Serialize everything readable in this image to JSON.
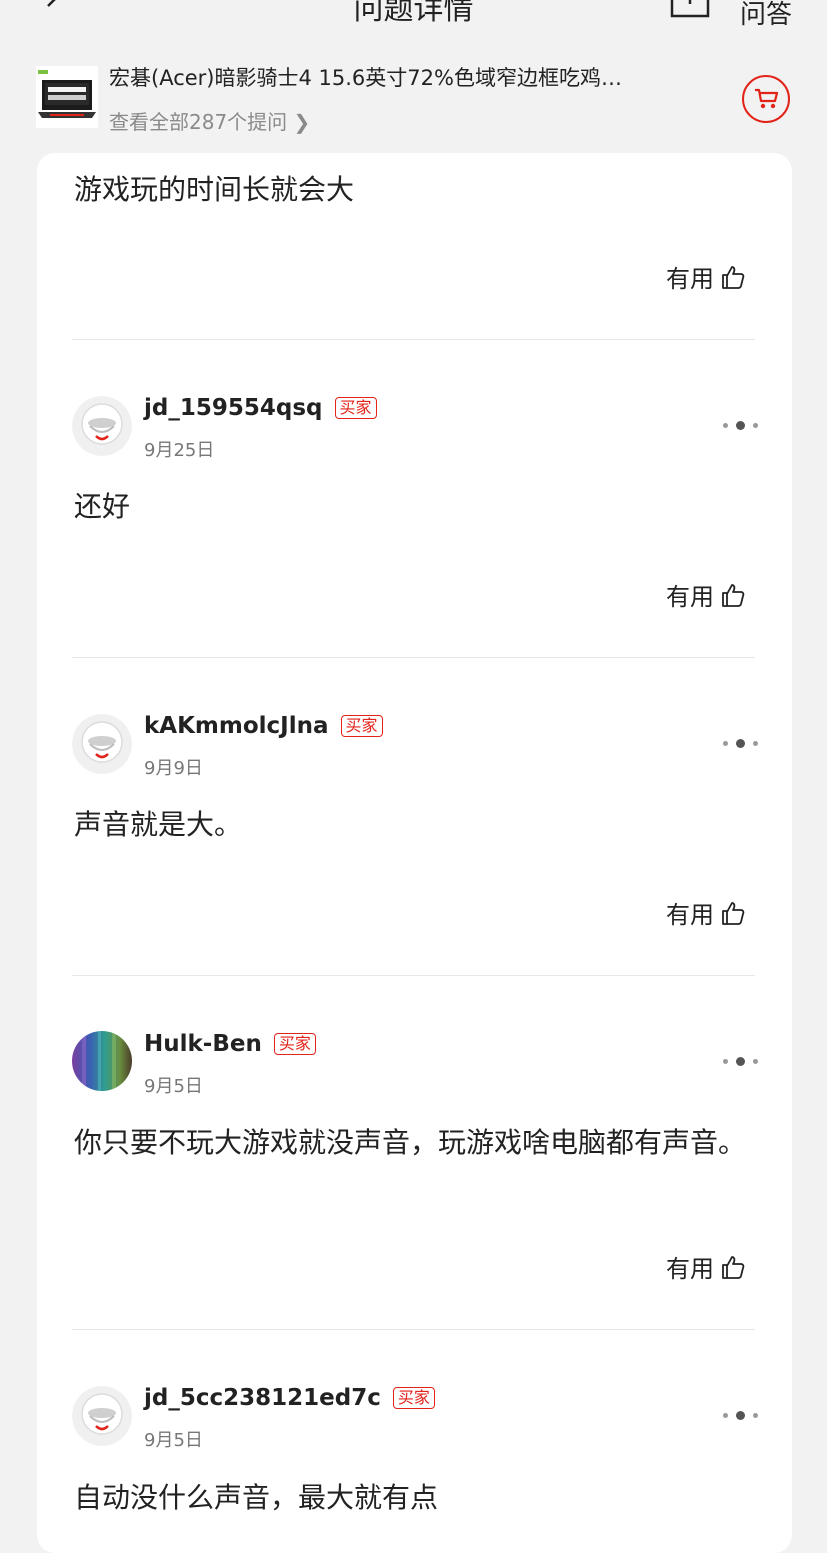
{
  "header": {
    "title": "问题详情",
    "qa_label": "问答"
  },
  "product": {
    "title": "宏碁(Acer)暗影骑士4 15.6英寸72%色域窄边框吃鸡…",
    "all_questions": "查看全部287个提问 ❯"
  },
  "answers": [
    {
      "text": "游戏玩的时间长就会大",
      "useful_label": "有用"
    },
    {
      "user": "jd_159554qsq",
      "badge": "买家",
      "date": "9月25日",
      "text": "还好",
      "useful_label": "有用",
      "avatar": "default-avatar"
    },
    {
      "user": "kAKmmolcJlna",
      "badge": "买家",
      "date": "9月9日",
      "text": "声音就是大。",
      "useful_label": "有用",
      "avatar": "default-avatar"
    },
    {
      "user": "Hulk-Ben",
      "badge": "买家",
      "date": "9月5日",
      "text": "你只要不玩大游戏就没声音，玩游戏啥电脑都有声音。",
      "useful_label": "有用",
      "avatar": "photo-avatar"
    },
    {
      "user": "jd_5cc238121ed7c",
      "badge": "买家",
      "date": "9月5日",
      "text": "自动没什么声音，最大就有点",
      "avatar": "default-avatar"
    }
  ],
  "colors": {
    "accent": "#e2231a",
    "background": "#f2f2f2",
    "card": "#ffffff"
  }
}
